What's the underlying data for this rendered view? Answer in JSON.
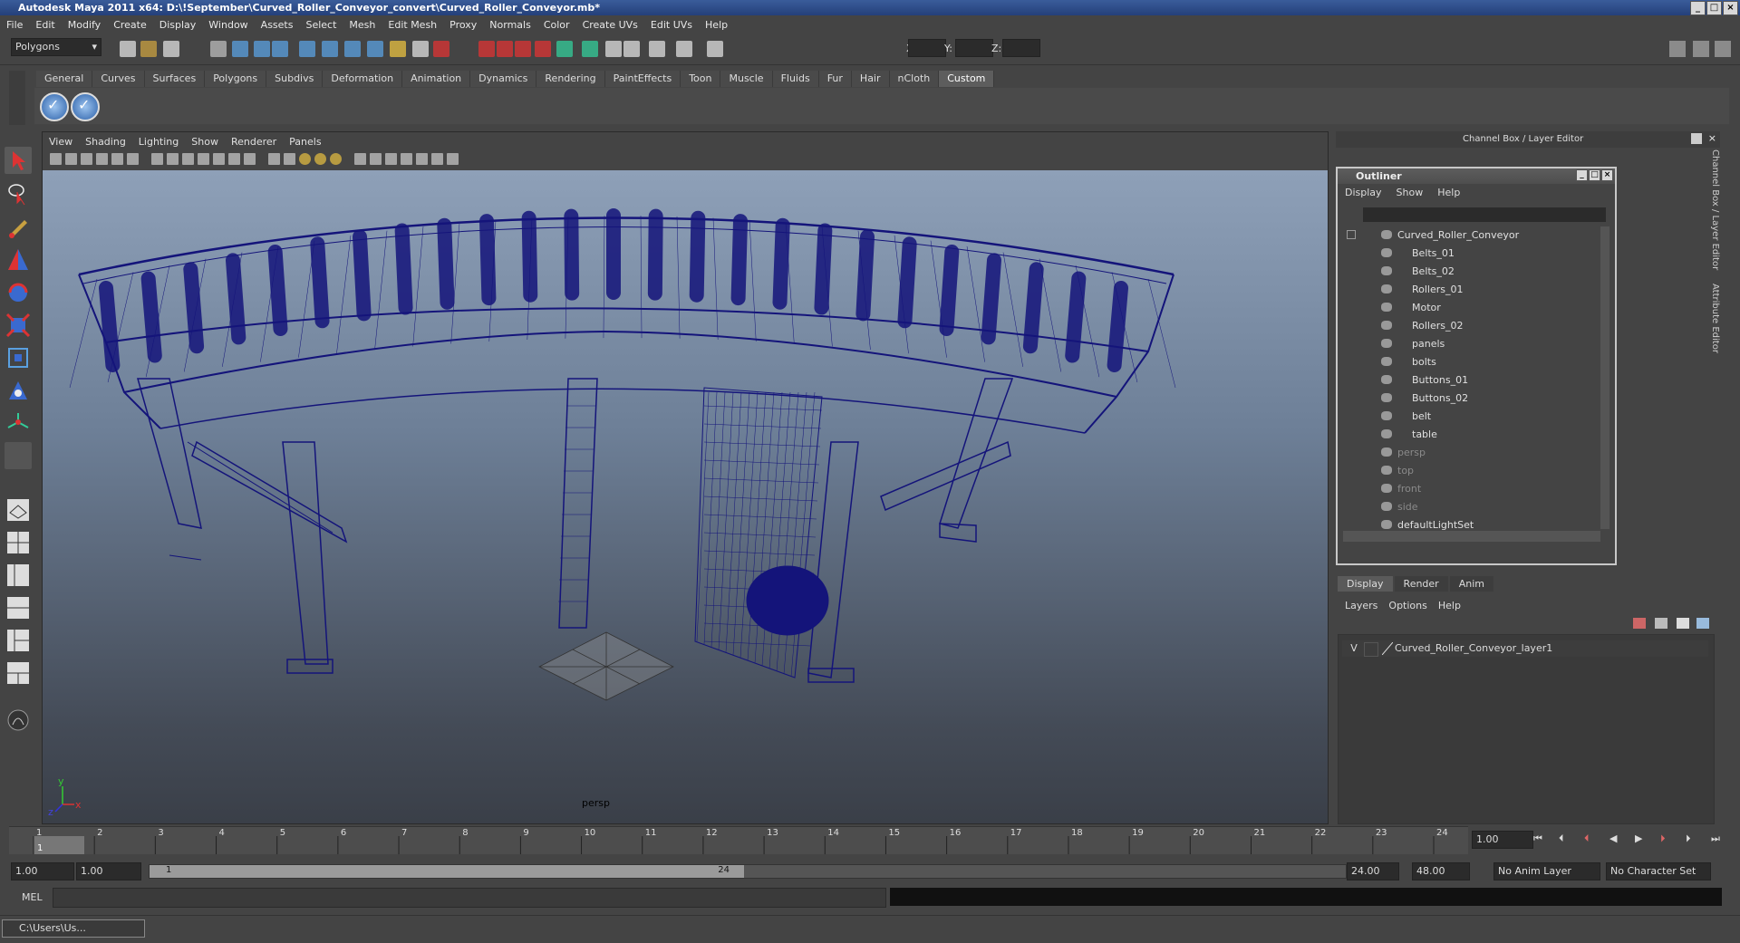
{
  "window": {
    "title": "Autodesk Maya 2011 x64: D:\\!September\\Curved_Roller_Conveyor_convert\\Curved_Roller_Conveyor.mb*",
    "controls": [
      "_",
      "□",
      "×"
    ]
  },
  "menubar": [
    "File",
    "Edit",
    "Modify",
    "Create",
    "Display",
    "Window",
    "Assets",
    "Select",
    "Mesh",
    "Edit Mesh",
    "Proxy",
    "Normals",
    "Color",
    "Create UVs",
    "Edit UVs",
    "Help"
  ],
  "statusline": {
    "mode": "Polygons",
    "x_label": "X:",
    "y_label": "Y:",
    "z_label": "Z:"
  },
  "shelf": {
    "tabs": [
      "General",
      "Curves",
      "Surfaces",
      "Polygons",
      "Subdivs",
      "Deformation",
      "Animation",
      "Dynamics",
      "Rendering",
      "PaintEffects",
      "Toon",
      "Muscle",
      "Fluids",
      "Fur",
      "Hair",
      "nCloth",
      "Custom"
    ],
    "active_tab": "Custom"
  },
  "viewport": {
    "menu": [
      "View",
      "Shading",
      "Lighting",
      "Show",
      "Renderer",
      "Panels"
    ],
    "camera_label": "persp",
    "axis_y": "y",
    "axis_x": "x",
    "axis_z": "z",
    "wire_color": "#14147a"
  },
  "right_panel": {
    "title": "Channel Box / Layer Editor",
    "side_tabs": [
      "Channel Box / Layer Editor",
      "Attribute Editor"
    ]
  },
  "outliner": {
    "title": "Outliner",
    "menu": [
      "Display",
      "Show",
      "Help"
    ],
    "root": "Curved_Roller_Conveyor",
    "children": [
      "Belts_01",
      "Belts_02",
      "Rollers_01",
      "Motor",
      "Rollers_02",
      "panels",
      "bolts",
      "Buttons_01",
      "Buttons_02",
      "belt",
      "table"
    ],
    "cameras": [
      "persp",
      "top",
      "front",
      "side"
    ],
    "sets": [
      "defaultLightSet"
    ]
  },
  "layer_editor": {
    "tabs": [
      "Display",
      "Render",
      "Anim"
    ],
    "active_tab": "Display",
    "menu": [
      "Layers",
      "Options",
      "Help"
    ],
    "layers": [
      {
        "visible": "V",
        "name": "Curved_Roller_Conveyor_layer1"
      }
    ]
  },
  "timeline": {
    "ticks": [
      "1",
      "2",
      "3",
      "4",
      "5",
      "6",
      "7",
      "8",
      "9",
      "10",
      "11",
      "12",
      "13",
      "14",
      "15",
      "16",
      "17",
      "18",
      "19",
      "20",
      "21",
      "22",
      "23",
      "24"
    ],
    "current_frame": "1",
    "current_time_field": "1.00"
  },
  "range": {
    "start": "1.00",
    "playback_start": "1.00",
    "slider_start": "1",
    "slider_end": "24",
    "playback_end": "24.00",
    "end": "48.00",
    "anim_layer": "No Anim Layer",
    "char_set": "No Character Set"
  },
  "cmdline": {
    "label": "MEL"
  },
  "taskbar": {
    "item": "C:\\Users\\Us..."
  }
}
